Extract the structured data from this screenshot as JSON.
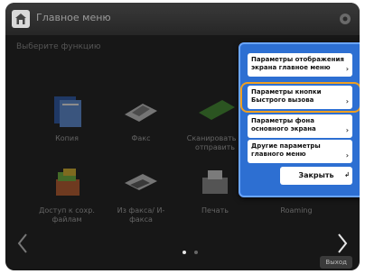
{
  "header": {
    "title": "Главное меню"
  },
  "subtitle": "Выберите функцию",
  "tiles": [
    {
      "label": "Копия",
      "icon": "copy-icon"
    },
    {
      "label": "Факс",
      "icon": "fax-icon"
    },
    {
      "label": "Сканировать и отправить",
      "icon": "scan-send-icon"
    },
    {
      "label": "",
      "icon": "hidden-icon"
    },
    {
      "label": "Доступ к сохр. файлам",
      "icon": "stored-files-icon"
    },
    {
      "label": "Из факса/ И-факса",
      "icon": "fax-forward-icon"
    },
    {
      "label": "Печать",
      "icon": "print-icon"
    },
    {
      "label": "Roaming",
      "icon": "roaming-icon"
    }
  ],
  "popup": {
    "items": [
      "Параметры отображения экрана главное меню",
      "Параметры кнопки Быстрого вызова",
      "Параметры фона основного экрана",
      "Другие параметры главного меню"
    ],
    "close_label": "Закрыть"
  },
  "footer": {
    "button_label": "Выход"
  },
  "colors": {
    "accent": "#2d6fd2",
    "highlight": "#f0a020",
    "background": "#2b2b2b"
  }
}
